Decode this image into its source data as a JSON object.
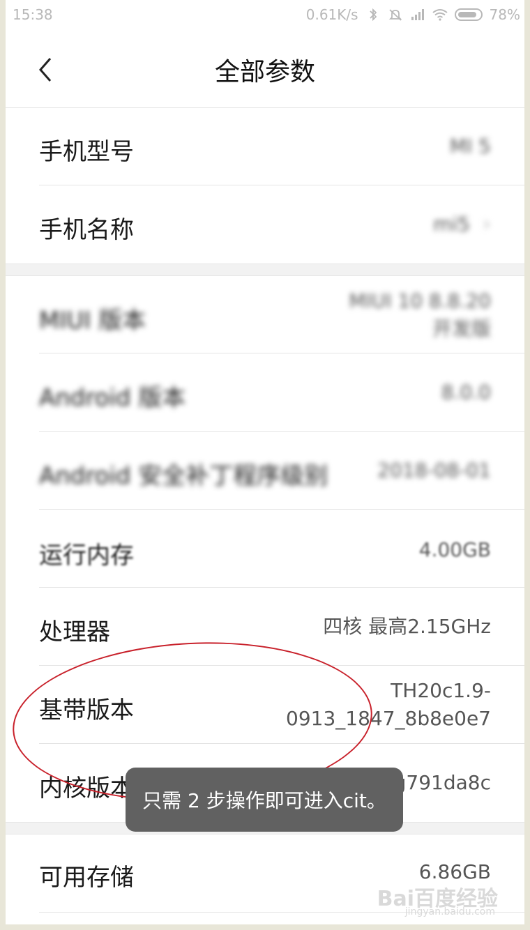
{
  "statusbar": {
    "time": "15:38",
    "network_speed": "0.61K/s",
    "battery": "78%"
  },
  "header": {
    "title": "全部参数"
  },
  "rows": [
    {
      "label": "手机型号",
      "value": "MI 5"
    },
    {
      "label": "手机名称",
      "value": "mi5"
    },
    {
      "label": "MIUI 版本",
      "value_line1": "MIUI 10 8.8.20",
      "value_line2": "开发版"
    },
    {
      "label": "Android 版本",
      "value": "8.0.0"
    },
    {
      "label": "Android 安全补丁程序级别",
      "value": "2018-08-01"
    },
    {
      "label": "运行内存",
      "value": "4.00GB"
    },
    {
      "label": "处理器",
      "value": "四核 最高2.15GHz"
    },
    {
      "label": "基带版本",
      "value_line1": "TH20c1.9-",
      "value_line2": "0913_1847_8b8e0e7"
    },
    {
      "label": "内核版本",
      "value": "3.18.71-perf-g791da8c"
    },
    {
      "label": "可用存储",
      "value": "6.86GB"
    }
  ],
  "toast": {
    "text": "只需 2 步操作即可进入cit。"
  },
  "watermark": {
    "main": "Bai百度经验",
    "sub": "jingyan.baidu.com"
  },
  "colors": {
    "annotation": "#c8202a",
    "toast_bg": "#616161"
  }
}
